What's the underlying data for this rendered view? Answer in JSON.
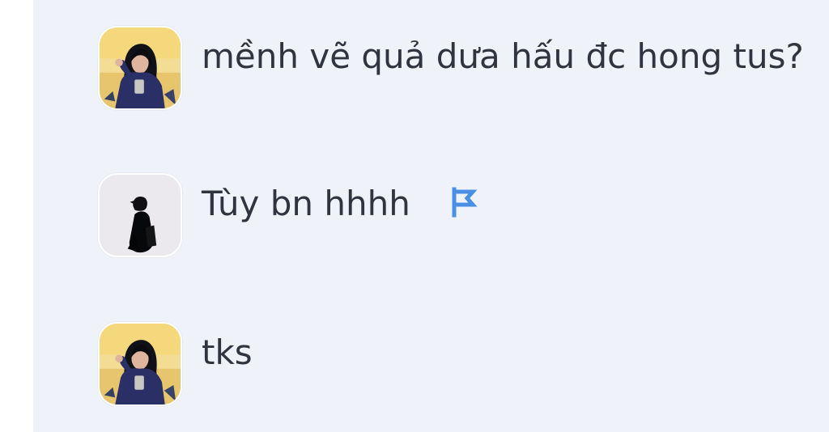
{
  "conversation": {
    "messages": [
      {
        "text": "mềnh vẽ quả dưa hấu đc hong tus?",
        "avatar": "girl-avatar"
      },
      {
        "text": "Tùy bn hhhh",
        "avatar": "boy-avatar",
        "icon": "flag-icon"
      },
      {
        "text": "tks",
        "avatar": "girl-avatar"
      }
    ]
  },
  "colors": {
    "panel_background": "#eff2f9",
    "text": "#2f3440",
    "flag": "#4a90e2"
  }
}
